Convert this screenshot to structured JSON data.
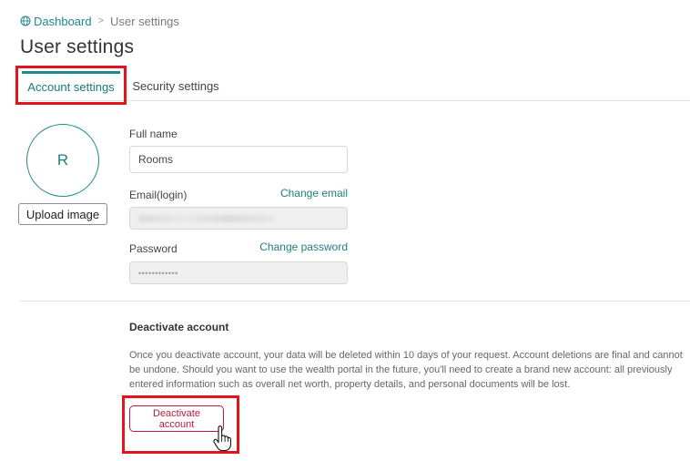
{
  "breadcrumb": {
    "home": "Dashboard",
    "separator": ">",
    "current": "User settings"
  },
  "page": {
    "title": "User settings"
  },
  "tabs": [
    {
      "label": "Account settings",
      "active": true
    },
    {
      "label": "Security settings",
      "active": false
    }
  ],
  "profile": {
    "avatar_initial": "R",
    "upload_label": "Upload image"
  },
  "form": {
    "full_name": {
      "label": "Full name",
      "value": "Rooms"
    },
    "email": {
      "label": "Email(login)",
      "action": "Change email"
    },
    "password": {
      "label": "Password",
      "action": "Change password",
      "masked": "••••••••••••"
    }
  },
  "deactivate": {
    "title": "Deactivate account",
    "body": "Once you deactivate account, your data will be deleted within 10 days of your request. Account deletions are final and cannot be undone. Should you want to use the wealth portal in the future, you'll need to create a brand new account: all previously entered information such as overall net worth, property details, and personal documents will be lost.",
    "button_label": "Deactivate account"
  },
  "colors": {
    "accent": "#1f8a87",
    "danger": "#b81c3c",
    "highlight": "#e3141c"
  },
  "icons": {
    "breadcrumb": "globe-icon",
    "cursor": "hand-pointer-icon"
  }
}
